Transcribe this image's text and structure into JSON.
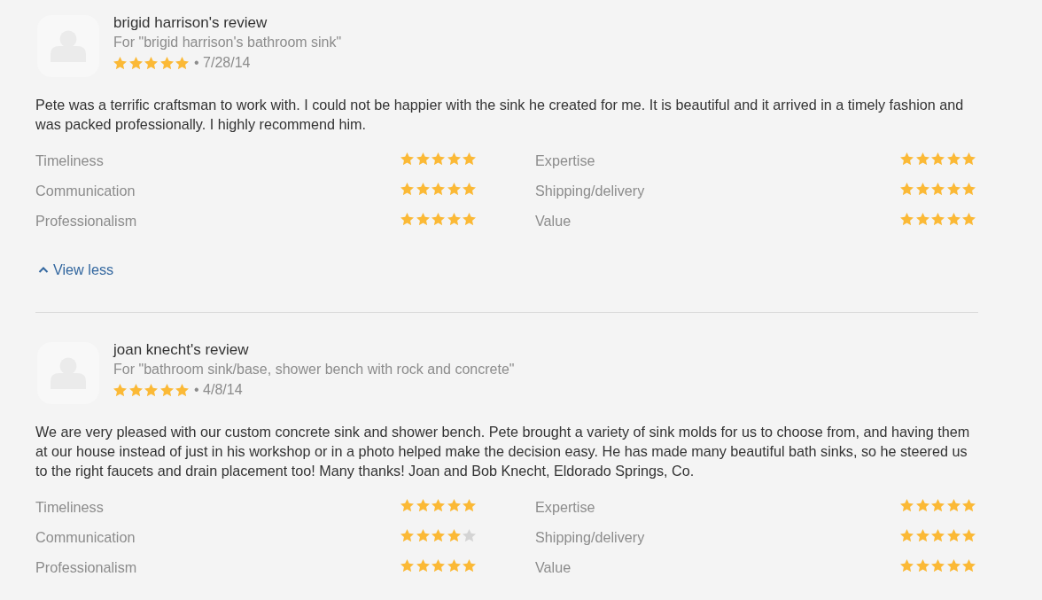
{
  "reviews": [
    {
      "title": "brigid harrison's review",
      "subtitle": "For \"brigid harrison's bathroom sink\"",
      "stars": 5,
      "date": "• 7/28/14",
      "text": "Pete was a terrific craftsman to work with. I could not be happier with the sink he created for me. It is beautiful and it arrived in a timely fashion and was packed professionally. I highly recommend him.",
      "ratings": [
        {
          "label": "Timeliness",
          "stars": 5
        },
        {
          "label": "Expertise",
          "stars": 5
        },
        {
          "label": "Communication",
          "stars": 5
        },
        {
          "label": "Shipping/delivery",
          "stars": 5
        },
        {
          "label": "Professionalism",
          "stars": 5
        },
        {
          "label": "Value",
          "stars": 5
        }
      ],
      "toggle": {
        "label": "View less",
        "expanded": true
      }
    },
    {
      "title": "joan knecht's review",
      "subtitle": "For \"bathroom sink/base, shower bench with rock and concrete\"",
      "stars": 5,
      "date": "• 4/8/14",
      "text": "We are very pleased with our custom concrete sink and shower bench. Pete brought a variety of sink molds for us to choose from, and having them at our house instead of just in his workshop or in a photo helped make the decision easy. He has made many beautiful bath sinks, so he steered us to the right faucets and drain placement too! Many thanks! Joan and Bob Knecht, Eldorado Springs, Co.",
      "ratings": [
        {
          "label": "Timeliness",
          "stars": 5
        },
        {
          "label": "Expertise",
          "stars": 5
        },
        {
          "label": "Communication",
          "stars": 4
        },
        {
          "label": "Shipping/delivery",
          "stars": 5
        },
        {
          "label": "Professionalism",
          "stars": 5
        },
        {
          "label": "Value",
          "stars": 5
        }
      ]
    }
  ]
}
